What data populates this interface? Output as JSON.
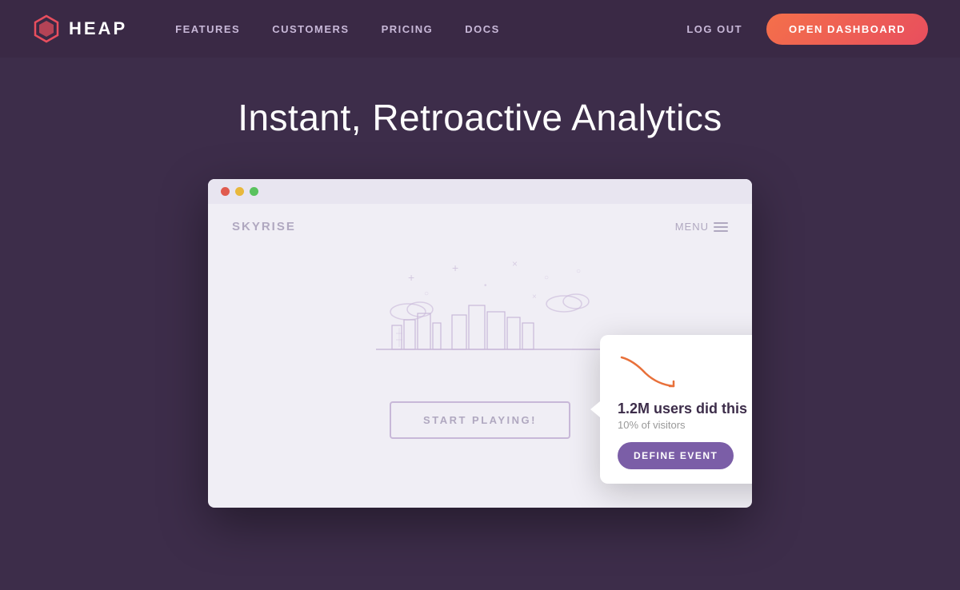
{
  "navbar": {
    "logo_text": "HEAP",
    "nav_links": [
      {
        "label": "FEATURES",
        "id": "features"
      },
      {
        "label": "CUSTOMERS",
        "id": "customers"
      },
      {
        "label": "PRICING",
        "id": "pricing"
      },
      {
        "label": "DOCS",
        "id": "docs"
      }
    ],
    "logout_label": "LOG OUT",
    "dashboard_label": "OPEN DASHBOARD"
  },
  "hero": {
    "title": "Instant, Retroactive Analytics"
  },
  "demo": {
    "app_name": "SKYRISE",
    "menu_label": "MENU",
    "start_button": "START PLAYING!",
    "tooltip": {
      "stat": "1.2M users did this",
      "sub": "10% of visitors",
      "button_label": "DEFINE EVENT"
    }
  }
}
